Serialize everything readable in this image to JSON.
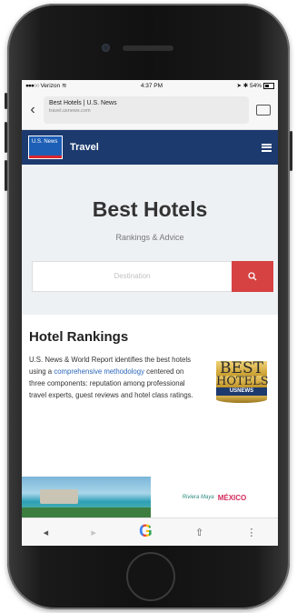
{
  "status": {
    "carrier": "Verizon",
    "time": "4:37 PM",
    "battery": "54%"
  },
  "browser": {
    "page_title": "Best Hotels | U.S. News",
    "domain": "travel.usnews.com"
  },
  "site": {
    "logo_text": "U.S. News",
    "section": "Travel"
  },
  "hero": {
    "title": "Best Hotels",
    "subtitle": "Rankings & Advice",
    "search_placeholder": "Destination"
  },
  "rankings": {
    "heading": "Hotel Rankings",
    "text_before": "U.S. News & World Report identifies the best hotels using a ",
    "link_text": "comprehensive methodology",
    "text_after": " centered on three components: reputation among professional travel experts, guest reviews and hotel class ratings."
  },
  "badge": {
    "line1": "BEST",
    "line2": "HOTELS",
    "line3": "USNEWS"
  },
  "ad": {
    "brand": "Riviera Maya",
    "country": "MÉXICO"
  },
  "icons": {
    "back": "chevron-left-icon",
    "tabs": "tabs-icon",
    "menu": "hamburger-icon",
    "search": "search-icon",
    "share": "share-icon",
    "more": "more-icon"
  },
  "colors": {
    "nav_blue": "#1c3a6e",
    "search_red": "#d64142",
    "link_blue": "#2a66b8"
  }
}
